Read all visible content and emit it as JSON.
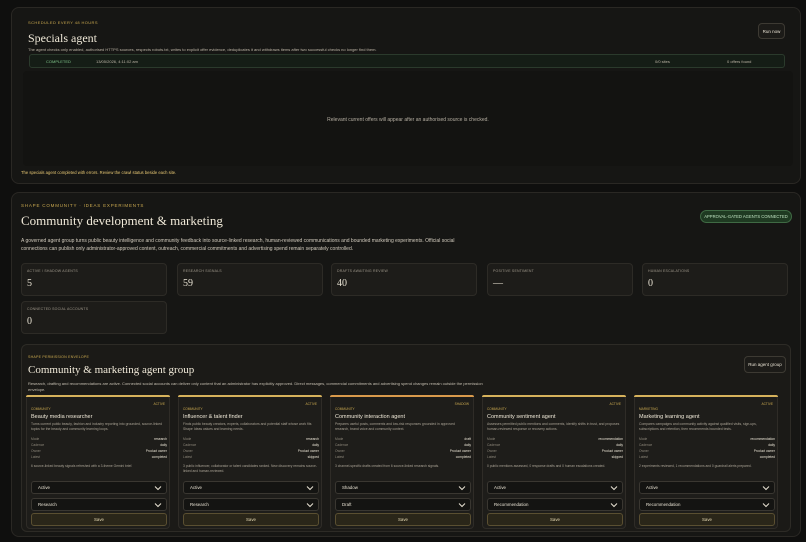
{
  "specials": {
    "eyebrow": "SCHEDULED EVERY 48 HOURS",
    "title": "Specials agent",
    "description": "The agent checks only enabled, authorised HTTPS sources, respects robots.txt, writes to explicit offer evidence, deduplicates it and withdraws items after two successful checks no longer find them.",
    "run_label": "Run now",
    "status": "COMPLETED",
    "run_time": "13/05/2026, 4:11:02 am",
    "sites": "0/0 sites",
    "offers": "0 offers found",
    "empty_message": "Relevant current offers will appear after an authorised source is checked.",
    "footer": "The specials agent completed with errors. Review the crawl status beside each site."
  },
  "community": {
    "eyebrow": "SHAPE COMMUNITY · IDEAS EXPERIMENTS",
    "title": "Community development & marketing",
    "badge": "APPROVAL-GATED AGENTS CONNECTED",
    "description": "A governed agent group turns public beauty intelligence and community feedback into source-linked research, human-reviewed communications and bounded marketing experiments. Official social connections can publish only administrator-approved content, outreach, commercial commitments and advertising spend remain separately controlled.",
    "metrics": [
      {
        "label": "ACTIVE / SHADOW AGENTS",
        "value": "5"
      },
      {
        "label": "RESEARCH SIGNALS",
        "value": "59"
      },
      {
        "label": "DRAFTS AWAITING REVIEW",
        "value": "40"
      },
      {
        "label": "POSITIVE SENTIMENT",
        "value": "—"
      },
      {
        "label": "HUMAN ESCALATIONS",
        "value": "0"
      },
      {
        "label": "CONNECTED SOCIAL ACCOUNTS",
        "value": "0"
      }
    ]
  },
  "group": {
    "eyebrow": "SHAPE PERMISSION ENVELOPE",
    "title": "Community & marketing agent group",
    "description": "Research, drafting and recommendations are active. Connected social accounts can deliver only content that an administrator has explicitly approved. Direct messages, commercial commitments and advertising spend changes remain outside the permission envelope.",
    "run_label": "Run agent group",
    "save_label": "Save",
    "keys": {
      "mode": "Mode",
      "cadence": "Cadence",
      "owner": "Owner",
      "latest": "Latest"
    },
    "cards": [
      {
        "category": "COMMUNITY",
        "state": "ACTIVE",
        "accent": "#d6b25c",
        "name": "Beauty media researcher",
        "description": "Turns current public beauty, fashion and industry reporting into grounded, source-linked topics for the beauty and community learning loops.",
        "mode": "research",
        "cadence": "daily",
        "owner": "Product owner",
        "latest": "completed",
        "summary": "6 source-linked beauty signals refreshed with a 3-theme Gemini brief.",
        "select_status": "Active",
        "select_mode": "Research"
      },
      {
        "category": "COMMUNITY",
        "state": "ACTIVE",
        "accent": "#d6b25c",
        "name": "Influencer & talent finder",
        "description": "Finds public beauty creators, experts, collaborators and potential staff whose work fits Shape Ideas values and learning needs.",
        "mode": "research",
        "cadence": "daily",
        "owner": "Product owner",
        "latest": "skipped",
        "summary": "3 public influencer, collaborator or talent candidates ranked. New discovery remains source-linked and human-reviewed.",
        "select_status": "Active",
        "select_mode": "Research"
      },
      {
        "category": "COMMUNITY",
        "state": "SHADOW",
        "accent": "#d99a4c",
        "name": "Community interaction agent",
        "description": "Prepares useful posts, comments and low-risk responses grounded in approved research, brand voice and community context.",
        "mode": "draft",
        "cadence": "daily",
        "owner": "Product owner",
        "latest": "completed",
        "summary": "3 channel-specific drafts created from 6 source-linked research signals.",
        "select_status": "Shadow",
        "select_mode": "Draft"
      },
      {
        "category": "COMMUNITY",
        "state": "ACTIVE",
        "accent": "#d6b25c",
        "name": "Community sentiment agent",
        "description": "Assesses permitted public mentions and comments, identify shifts in trust, and proposes human-reviewed response or recovery actions.",
        "mode": "recommendation",
        "cadence": "daily",
        "owner": "Product owner",
        "latest": "skipped",
        "summary": "0 public mentions assessed, 0 response drafts and 0 human escalations created.",
        "select_status": "Active",
        "select_mode": "Recommendation"
      },
      {
        "category": "MARKETING",
        "state": "ACTIVE",
        "accent": "#d6b25c",
        "name": "Marketing learning agent",
        "description": "Compares campaigns and community activity against qualified visits, sign-ups, subscriptions and retention, then recommends bounded tests.",
        "mode": "recommendation",
        "cadence": "daily",
        "owner": "Product owner",
        "latest": "completed",
        "summary": "2 experiments reviewed, 1 recommendations and 0 guardrail alerts prepared.",
        "select_status": "Active",
        "select_mode": "Recommendation"
      }
    ]
  }
}
